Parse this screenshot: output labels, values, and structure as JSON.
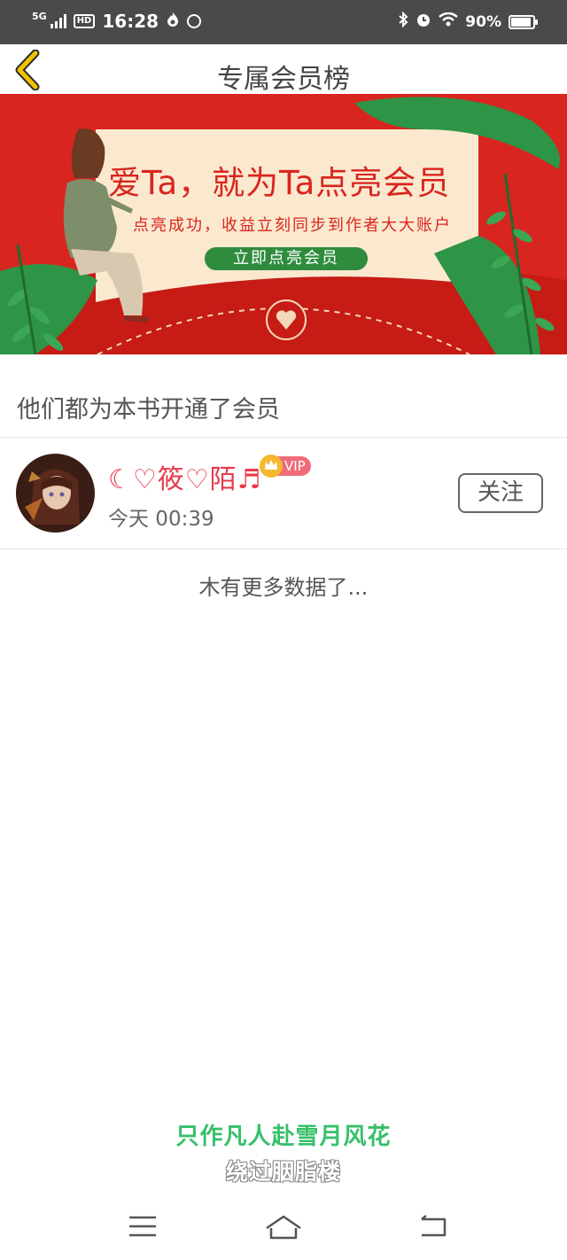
{
  "status_bar": {
    "network": "5G",
    "hd_label": "HD",
    "time": "16:28",
    "battery_percent": "90%",
    "battery_level": 0.9,
    "icons": [
      "signal-icon",
      "hd-icon",
      "flame-icon",
      "app-icon",
      "bluetooth-icon",
      "alarm-icon",
      "wifi-icon",
      "battery-icon"
    ]
  },
  "header": {
    "title": "专属会员榜",
    "back_icon": "chevron-left-icon",
    "accent": "#f2c300"
  },
  "banner": {
    "headline": "爱Ta，就为Ta点亮会员",
    "subline": "点亮成功，收益立刻同步到作者大大账户",
    "cta_label": "立即点亮会员",
    "colors": {
      "background": "#d9251f",
      "card": "#fbe9cf",
      "cta": "#2f8c3e",
      "headline": "#d9251f"
    }
  },
  "section": {
    "title": "他们都为本书开通了会员"
  },
  "members": [
    {
      "name": "☾♡筱♡陌♬",
      "vip_label": "VIP",
      "time": "今天 00:39",
      "follow_label": "关注"
    }
  ],
  "list_end_text": "木有更多数据了...",
  "subtitles": {
    "line1": "只作凡人赴雪月风花",
    "line2": "绕过胭脂楼"
  },
  "system_nav": {
    "icons": [
      "menu-icon",
      "home-icon",
      "back-icon"
    ]
  }
}
